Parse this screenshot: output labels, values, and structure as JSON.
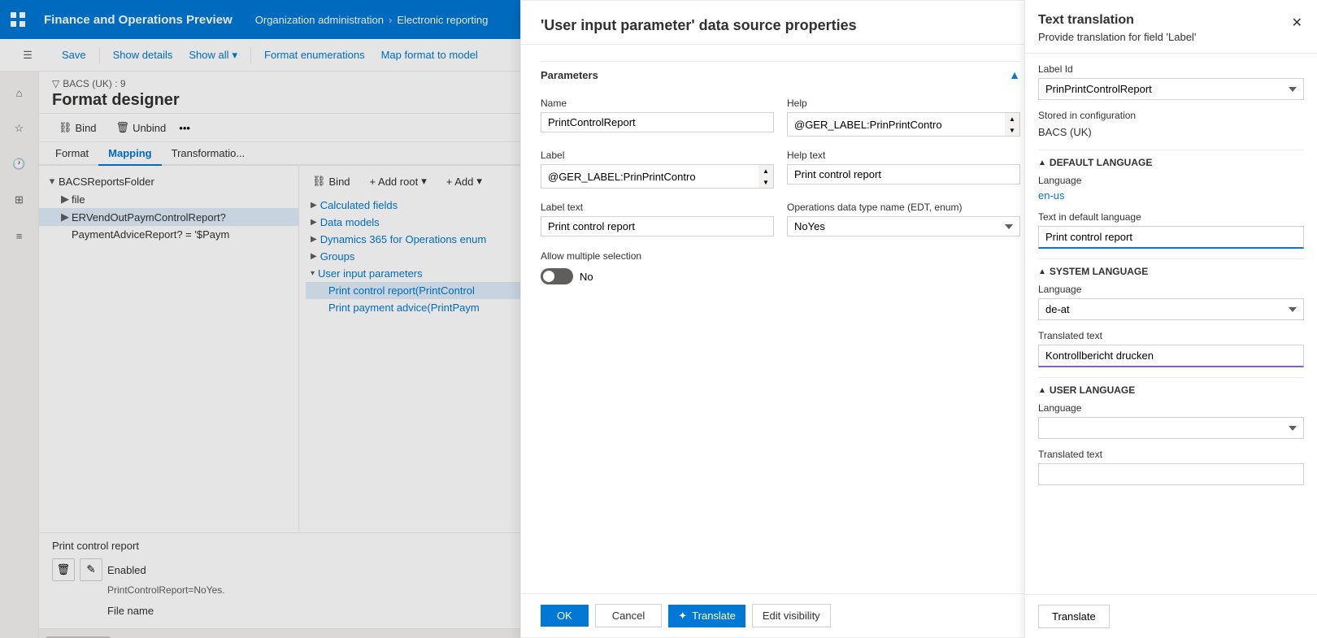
{
  "topbar": {
    "app_title": "Finance and Operations Preview",
    "nav1": "Organization administration",
    "nav2": "Electronic reporting",
    "help_label": "?"
  },
  "toolbar": {
    "save_label": "Save",
    "show_details_label": "Show details",
    "show_all_label": "Show all",
    "format_enumerations_label": "Format enumerations",
    "map_format_label": "Map format to model"
  },
  "designer": {
    "breadcrumb": "BACS (UK) : 9",
    "title": "Format designer",
    "bind_label": "Bind",
    "unbind_label": "Unbind",
    "add_root_label": "+ Add root",
    "add_label": "+ Add",
    "tabs": {
      "format": "Format",
      "mapping": "Mapping",
      "transformation": "Transformatio..."
    }
  },
  "tree": {
    "items": [
      {
        "label": "BACSReportsFolder",
        "indent": 0,
        "has_children": true,
        "expanded": true
      },
      {
        "label": "file",
        "indent": 1,
        "has_children": true,
        "expanded": false
      },
      {
        "label": "ERVendOutPaymControlReport?",
        "indent": 1,
        "has_children": true,
        "expanded": false,
        "selected": true
      },
      {
        "label": "PaymentAdviceReport? = '$Paym",
        "indent": 1,
        "has_children": false
      }
    ]
  },
  "datasources": {
    "items": [
      {
        "label": "Calculated fields",
        "indent": 1,
        "type": "folder"
      },
      {
        "label": "Data models",
        "indent": 1,
        "type": "folder"
      },
      {
        "label": "Dynamics 365 for Operations enum",
        "indent": 1,
        "type": "folder"
      },
      {
        "label": "Groups",
        "indent": 1,
        "type": "folder"
      },
      {
        "label": "User input parameters",
        "indent": 1,
        "type": "folder",
        "expanded": true
      },
      {
        "label": "Print control report(PrintControl",
        "indent": 2,
        "type": "item",
        "selected": true
      },
      {
        "label": "Print payment advice(PrintPaym",
        "indent": 2,
        "type": "item"
      }
    ]
  },
  "bottom_detail": {
    "label": "Print control report",
    "btn1_label": "🗑",
    "btn2_label": "✎",
    "enabled_label": "Enabled",
    "enabled_value": "PrintControlReport=NoYes.",
    "file_name_label": "File name"
  },
  "modal": {
    "title": "'User input parameter' data source properties",
    "sections": {
      "parameters": "Parameters"
    },
    "fields": {
      "name_label": "Name",
      "name_value": "PrintControlReport",
      "label_label": "Label",
      "label_value": "@GER_LABEL:PrinPrintContro",
      "label_text_label": "Label text",
      "label_text_value": "Print control report",
      "help_label": "Help",
      "help_value": "@GER_LABEL:PrinPrintContro",
      "help_text_label": "Help text",
      "help_text_value": "Print control report",
      "operations_label": "Operations data type name (EDT, enum)",
      "operations_value": "NoYes",
      "allow_multiple_label": "Allow multiple selection",
      "allow_multiple_value": "No"
    },
    "buttons": {
      "ok": "OK",
      "cancel": "Cancel",
      "translate": "Translate",
      "edit_visibility": "Edit visibility"
    }
  },
  "right_panel": {
    "title": "Text translation",
    "subtitle": "Provide translation for field 'Label'",
    "label_id_label": "Label Id",
    "label_id_value": "PrinPrintControlReport",
    "stored_in_label": "Stored in configuration",
    "stored_in_value": "BACS (UK)",
    "default_language_section": "DEFAULT LANGUAGE",
    "language_label": "Language",
    "default_language_value": "en-us",
    "text_default_label": "Text in default language",
    "text_default_value": "Print control report",
    "system_language_section": "SYSTEM LANGUAGE",
    "system_language_value": "de-at",
    "translated_text_label": "Translated text",
    "system_translated_value": "Kontrollbericht drucken",
    "user_language_section": "USER LANGUAGE",
    "user_language_value": "",
    "user_translated_value": "",
    "translate_btn": "Translate"
  }
}
